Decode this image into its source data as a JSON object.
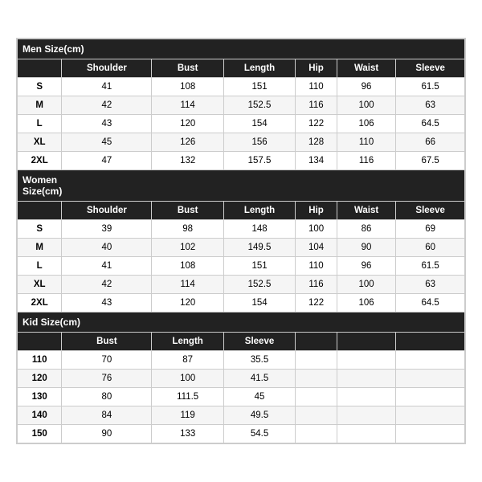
{
  "men": {
    "section_label": "Men Size(cm)",
    "columns": [
      "Shoulder",
      "Bust",
      "Length",
      "Hip",
      "Waist",
      "Sleeve"
    ],
    "rows": [
      {
        "size": "S",
        "shoulder": "41",
        "bust": "108",
        "length": "151",
        "hip": "110",
        "waist": "96",
        "sleeve": "61.5"
      },
      {
        "size": "M",
        "shoulder": "42",
        "bust": "114",
        "length": "152.5",
        "hip": "116",
        "waist": "100",
        "sleeve": "63"
      },
      {
        "size": "L",
        "shoulder": "43",
        "bust": "120",
        "length": "154",
        "hip": "122",
        "waist": "106",
        "sleeve": "64.5"
      },
      {
        "size": "XL",
        "shoulder": "45",
        "bust": "126",
        "length": "156",
        "hip": "128",
        "waist": "110",
        "sleeve": "66"
      },
      {
        "size": "2XL",
        "shoulder": "47",
        "bust": "132",
        "length": "157.5",
        "hip": "134",
        "waist": "116",
        "sleeve": "67.5"
      }
    ]
  },
  "women": {
    "section_label": "Women\nSize(cm)",
    "columns": [
      "Shoulder",
      "Bust",
      "Length",
      "Hip",
      "Waist",
      "Sleeve"
    ],
    "rows": [
      {
        "size": "S",
        "shoulder": "39",
        "bust": "98",
        "length": "148",
        "hip": "100",
        "waist": "86",
        "sleeve": "69"
      },
      {
        "size": "M",
        "shoulder": "40",
        "bust": "102",
        "length": "149.5",
        "hip": "104",
        "waist": "90",
        "sleeve": "60"
      },
      {
        "size": "L",
        "shoulder": "41",
        "bust": "108",
        "length": "151",
        "hip": "110",
        "waist": "96",
        "sleeve": "61.5"
      },
      {
        "size": "XL",
        "shoulder": "42",
        "bust": "114",
        "length": "152.5",
        "hip": "116",
        "waist": "100",
        "sleeve": "63"
      },
      {
        "size": "2XL",
        "shoulder": "43",
        "bust": "120",
        "length": "154",
        "hip": "122",
        "waist": "106",
        "sleeve": "64.5"
      }
    ]
  },
  "kid": {
    "section_label": "Kid Size(cm)",
    "columns": [
      "Bust",
      "Length",
      "Sleeve"
    ],
    "rows": [
      {
        "size": "110",
        "bust": "70",
        "length": "87",
        "sleeve": "35.5"
      },
      {
        "size": "120",
        "bust": "76",
        "length": "100",
        "sleeve": "41.5"
      },
      {
        "size": "130",
        "bust": "80",
        "length": "111.5",
        "sleeve": "45"
      },
      {
        "size": "140",
        "bust": "84",
        "length": "119",
        "sleeve": "49.5"
      },
      {
        "size": "150",
        "bust": "90",
        "length": "133",
        "sleeve": "54.5"
      }
    ]
  }
}
